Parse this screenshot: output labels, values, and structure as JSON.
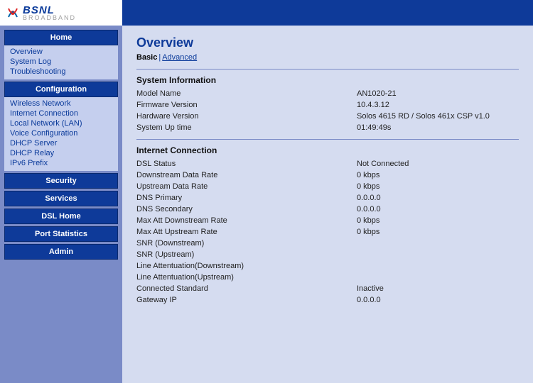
{
  "logo": {
    "brand": "BSNL",
    "sub": "BROADBAND"
  },
  "nav": {
    "home": {
      "header": "Home",
      "items": [
        "Overview",
        "System Log",
        "Troubleshooting"
      ]
    },
    "configuration": {
      "header": "Configuration",
      "items": [
        "Wireless Network",
        "Internet Connection",
        "Local Network (LAN)",
        "Voice Configuration",
        "DHCP Server",
        "DHCP Relay",
        "IPv6 Prefix"
      ]
    },
    "security": {
      "header": "Security"
    },
    "services": {
      "header": "Services"
    },
    "dslhome": {
      "header": "DSL Home"
    },
    "portstats": {
      "header": "Port Statistics"
    },
    "admin": {
      "header": "Admin"
    }
  },
  "page": {
    "title": "Overview",
    "tab_active": "Basic",
    "tab_other": "Advanced"
  },
  "sysinfo": {
    "title": "System Information",
    "rows": [
      {
        "label": "Model Name",
        "value": "AN1020-21"
      },
      {
        "label": "Firmware Version",
        "value": "10.4.3.12"
      },
      {
        "label": "Hardware Version",
        "value": "Solos 4615 RD / Solos 461x CSP v1.0"
      },
      {
        "label": "System Up time",
        "value": "01:49:49s"
      }
    ]
  },
  "netconn": {
    "title": "Internet Connection",
    "rows": [
      {
        "label": "DSL Status",
        "value": "Not Connected"
      },
      {
        "label": "Downstream Data Rate",
        "value": "0 kbps"
      },
      {
        "label": "Upstream Data Rate",
        "value": "0 kbps"
      },
      {
        "label": "DNS Primary",
        "value": "0.0.0.0"
      },
      {
        "label": "DNS Secondary",
        "value": "0.0.0.0"
      },
      {
        "label": "Max Att Downstream Rate",
        "value": "0 kbps"
      },
      {
        "label": "Max Att Upstream Rate",
        "value": "0 kbps"
      },
      {
        "label": "SNR (Downstream)",
        "value": ""
      },
      {
        "label": "SNR (Upstream)",
        "value": ""
      },
      {
        "label": "Line Attentuation(Downstream)",
        "value": ""
      },
      {
        "label": "Line Attentuation(Upstream)",
        "value": ""
      },
      {
        "label": "Connected Standard",
        "value": "Inactive"
      },
      {
        "label": "Gateway IP",
        "value": "0.0.0.0"
      }
    ]
  }
}
